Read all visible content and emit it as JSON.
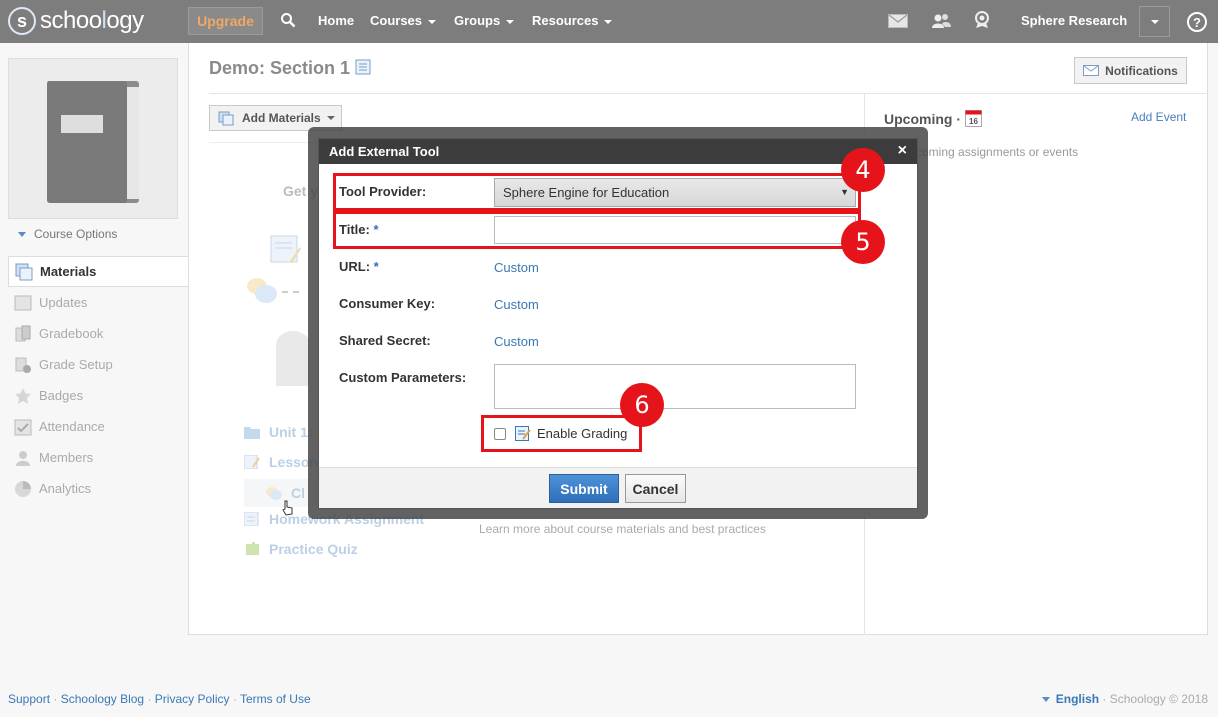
{
  "topnav": {
    "logo_letter": "s",
    "logo_text_start": "schoo",
    "logo_text_oo": "l",
    "logo_text_end": "ogy",
    "upgrade": "Upgrade",
    "home": "Home",
    "courses": "Courses",
    "groups": "Groups",
    "resources": "Resources",
    "user": "Sphere Research",
    "help": "?"
  },
  "sidebar": {
    "course_options": "Course Options",
    "items": [
      {
        "label": "Materials",
        "icon": "materials-icon"
      },
      {
        "label": "Updates",
        "icon": "updates-icon"
      },
      {
        "label": "Gradebook",
        "icon": "gradebook-icon"
      },
      {
        "label": "Grade Setup",
        "icon": "grade-setup-icon"
      },
      {
        "label": "Badges",
        "icon": "badges-icon"
      },
      {
        "label": "Attendance",
        "icon": "attendance-icon"
      },
      {
        "label": "Members",
        "icon": "members-icon"
      },
      {
        "label": "Analytics",
        "icon": "analytics-icon"
      }
    ]
  },
  "main": {
    "title": "Demo: Section 1",
    "notifications": "Notifications",
    "add_materials": "Add Materials",
    "get_started": "Get y",
    "materials": [
      "Unit 1:",
      "Lesson",
      "Cl",
      "Homework Assignment",
      "Practice Quiz"
    ],
    "learn_more": "Learn more about course materials and best practices"
  },
  "upcoming": {
    "title": "Upcoming ·",
    "calendar_day": "16",
    "add_event": "Add Event",
    "empty": "coming assignments or events"
  },
  "dialog": {
    "title": "Add External Tool",
    "close": "×",
    "tool_provider_label": "Tool Provider:",
    "tool_provider_value": "Sphere Engine for Education",
    "title_label": "Title:",
    "required_mark": "*",
    "url_label": "URL:",
    "url_value": "Custom",
    "consumer_key_label": "Consumer Key:",
    "consumer_key_value": "Custom",
    "shared_secret_label": "Shared Secret:",
    "shared_secret_value": "Custom",
    "custom_params_label": "Custom Parameters:",
    "enable_grading": "Enable Grading",
    "submit": "Submit",
    "cancel": "Cancel"
  },
  "annotations": {
    "step4": "4",
    "step5": "5",
    "step6": "6",
    "color": "#e5141b"
  },
  "footer": {
    "links": [
      "Support",
      "Schoology Blog",
      "Privacy Policy",
      "Terms of Use"
    ],
    "separator": "·",
    "language": "English",
    "copyright": "· Schoology © 2018"
  }
}
